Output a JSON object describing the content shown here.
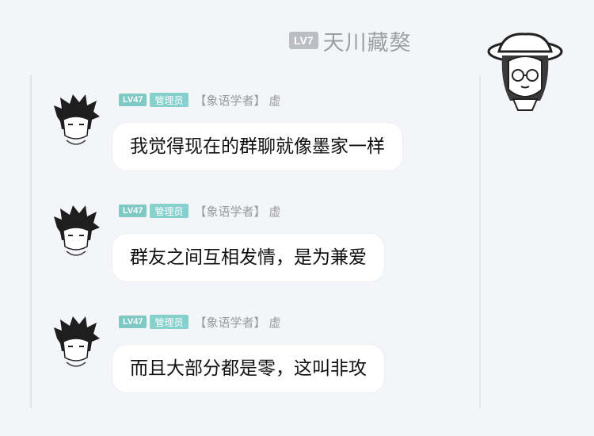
{
  "header": {
    "level": "LV7",
    "name": "天川藏獒"
  },
  "messages": [
    {
      "level": "LV47",
      "role": "管理员",
      "title": "【象语学者】",
      "nickname": "虚",
      "text": "我觉得现在的群聊就像墨家一样"
    },
    {
      "level": "LV47",
      "role": "管理员",
      "title": "【象语学者】",
      "nickname": "虚",
      "text": "群友之间互相发情，是为兼爱"
    },
    {
      "level": "LV47",
      "role": "管理员",
      "title": "【象语学者】",
      "nickname": "虚",
      "text": "而且大部分都是零，这叫非攻"
    }
  ],
  "colors": {
    "background": "#f4f5f8",
    "bubble": "#ffffff",
    "role_badge": "#86d0cd",
    "self_level_badge": "#bcbec4"
  }
}
